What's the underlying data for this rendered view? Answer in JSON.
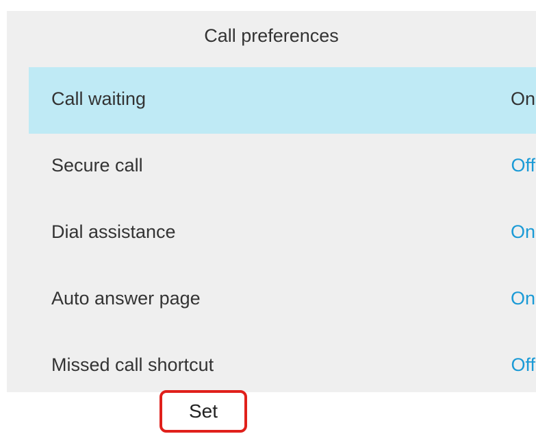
{
  "header": {
    "title": "Call preferences"
  },
  "settings": {
    "items": [
      {
        "label": "Call waiting",
        "value": "On",
        "selected": true
      },
      {
        "label": "Secure call",
        "value": "Off",
        "selected": false
      },
      {
        "label": "Dial assistance",
        "value": "On",
        "selected": false
      },
      {
        "label": "Auto answer page",
        "value": "On",
        "selected": false
      },
      {
        "label": "Missed call shortcut",
        "value": "Off",
        "selected": false
      }
    ]
  },
  "softkeys": {
    "set_label": "Set"
  },
  "colors": {
    "selected_row": "#bfeaf5",
    "value_text": "#1a9ad6",
    "panel_bg": "#efefef",
    "highlight_border": "#e0201b"
  }
}
